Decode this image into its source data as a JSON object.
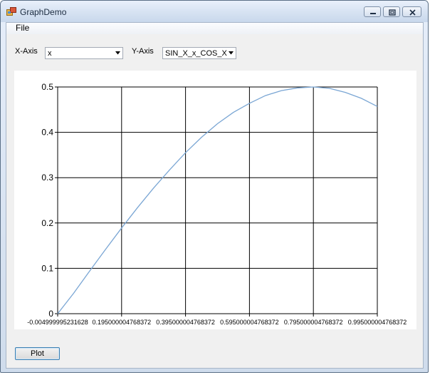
{
  "window": {
    "title": "GraphDemo"
  },
  "menu": {
    "items": [
      {
        "label": "File"
      }
    ]
  },
  "controls": {
    "x_axis_label": "X-Axis",
    "x_axis_value": "x",
    "y_axis_label": "Y-Axis",
    "y_axis_value": "SIN_X_x_COS_X",
    "plot_button": "Plot"
  },
  "colors": {
    "series": "#7aa6d4",
    "grid": "#000000"
  },
  "chart_data": {
    "type": "line",
    "title": "",
    "xlabel": "",
    "ylabel": "",
    "xlim": [
      -0.004999995231628,
      0.995000004768372
    ],
    "ylim": [
      0,
      0.5
    ],
    "x_tick_labels": [
      "-0.004999995231628",
      "0.195000004768372",
      "0.395000004768372",
      "0.595000004768372",
      "0.795000004768372",
      "0.995000004768372"
    ],
    "y_tick_labels": [
      "0",
      "0.1",
      "0.2",
      "0.3",
      "0.4",
      "0.5"
    ],
    "grid": true,
    "series": [
      {
        "x": [
          -0.005,
          0.045,
          0.095,
          0.145,
          0.195,
          0.245,
          0.295,
          0.345,
          0.395,
          0.445,
          0.495,
          0.545,
          0.595,
          0.645,
          0.695,
          0.745,
          0.795,
          0.845,
          0.895,
          0.945,
          0.995
        ],
        "y": [
          -0.005,
          0.045,
          0.094,
          0.142,
          0.189,
          0.234,
          0.277,
          0.317,
          0.355,
          0.389,
          0.419,
          0.444,
          0.464,
          0.481,
          0.492,
          0.498,
          0.5,
          0.497,
          0.488,
          0.475,
          0.457
        ]
      }
    ]
  }
}
